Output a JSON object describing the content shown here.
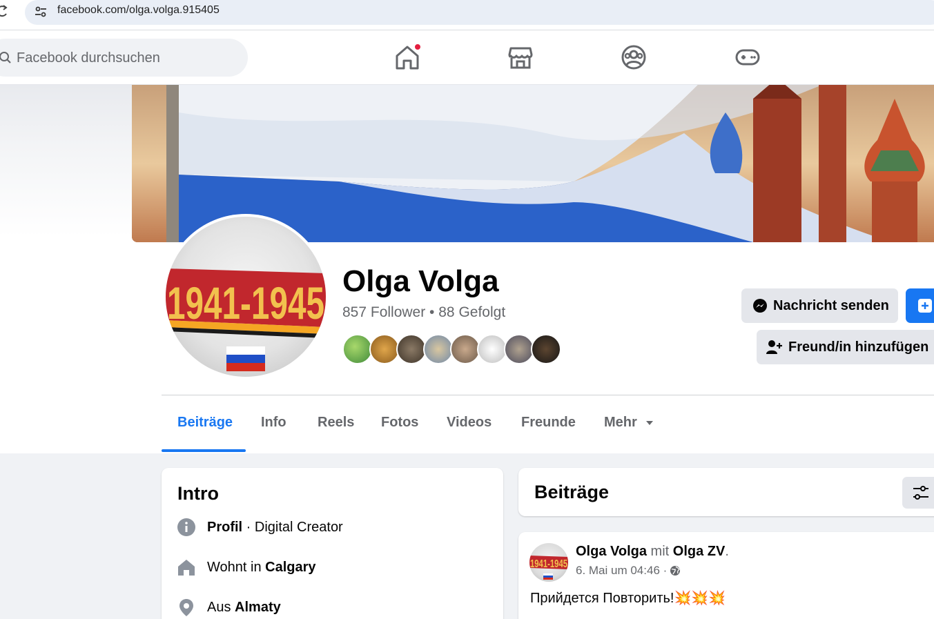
{
  "browser": {
    "url": "facebook.com/olga.volga.915405"
  },
  "topnav": {
    "search_placeholder": "Facebook durchsuchen",
    "icons": [
      "home-icon",
      "marketplace-icon",
      "groups-icon",
      "gaming-icon"
    ],
    "home_has_notification": true
  },
  "profile": {
    "name": "Olga Volga",
    "stats": "857 Follower • 88 Gefolgt",
    "avatar_text": "1941-1945",
    "message_button": "Nachricht senden",
    "add_friend_button": "Freund/in hinzufügen"
  },
  "tabs": [
    {
      "label": "Beiträge",
      "active": true
    },
    {
      "label": "Info"
    },
    {
      "label": "Reels"
    },
    {
      "label": "Fotos"
    },
    {
      "label": "Videos"
    },
    {
      "label": "Freunde"
    },
    {
      "label": "Mehr"
    }
  ],
  "intro": {
    "title": "Intro",
    "rows": [
      {
        "icon": "info-icon",
        "bold": "Profil",
        "text": " · Digital Creator"
      },
      {
        "icon": "home-icon",
        "prefix": "Wohnt in ",
        "bold": "Calgary"
      },
      {
        "icon": "location-pin-icon",
        "prefix": "Aus ",
        "bold": "Almaty"
      }
    ]
  },
  "posts": {
    "title": "Beiträge",
    "post": {
      "author": "Olga Volga",
      "with_word": "mit",
      "tagged": "Olga ZV",
      "date": "6. Mai um 04:46 ·",
      "text": "Прийдется Повторить!💥💥💥"
    }
  },
  "colors": {
    "accent": "#1877f2",
    "notification": "#e41e3f"
  }
}
